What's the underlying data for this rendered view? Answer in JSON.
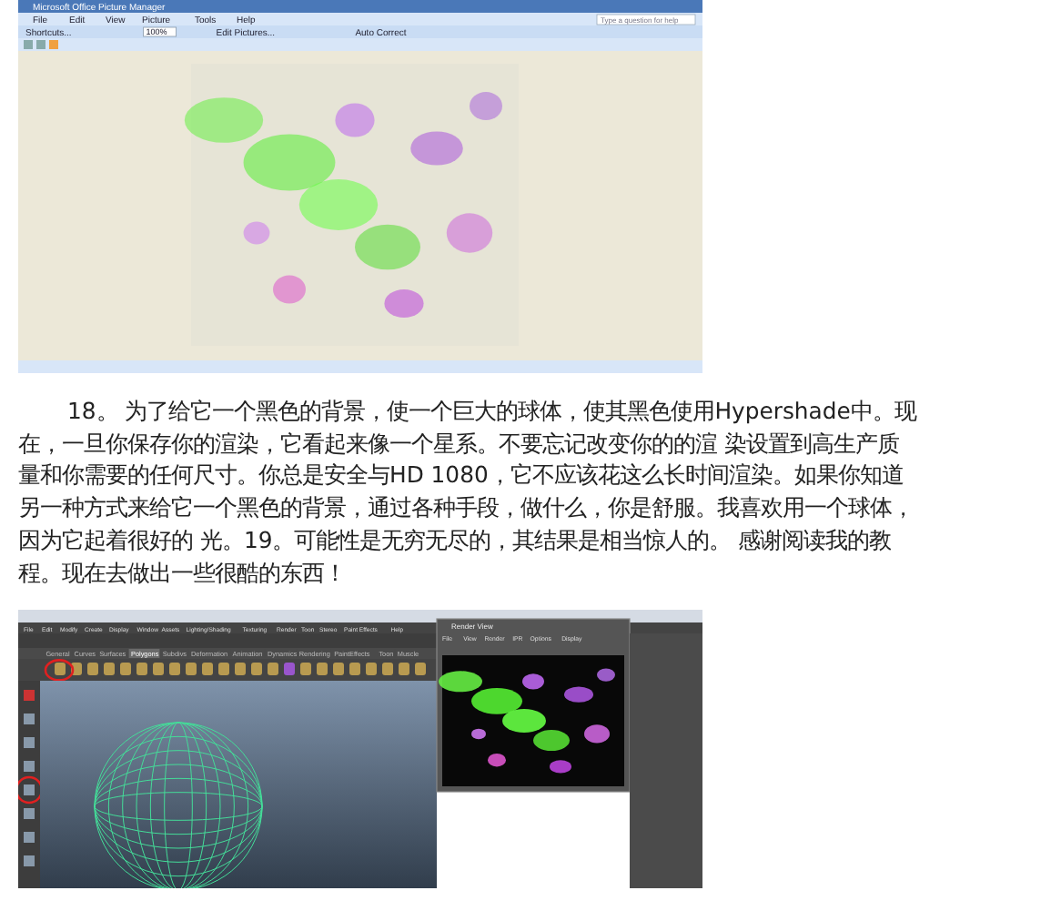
{
  "top_screenshot": {
    "window_title": "Microsoft Office Picture Manager",
    "menu": [
      "File",
      "Edit",
      "View",
      "Picture",
      "Tools",
      "Help"
    ],
    "help_placeholder": "Type a question for help",
    "toolbar": [
      {
        "kind": "button",
        "label": "Shortcuts..."
      },
      {
        "kind": "zoom",
        "label": "100%"
      },
      {
        "kind": "button",
        "label": "Edit Pictures..."
      },
      {
        "kind": "button",
        "label": "Auto Correct"
      }
    ]
  },
  "paragraph": "18。 为了给它一个黑色的背景，使一个巨大的球体，使其黑色使用Hypershade中。现在，一旦你保存你的渲染，它看起来像一个星系。不要忘记改变你的的渲 染设置到高生产质量和你需要的任何尺寸。你总是安全与HD 1080，它不应该花这么长时间渲染。如果你知道另一种方式来给它一个黑色的背景，通过各种手段，做什么，你是舒服。我喜欢用一个球体，因为它起着很好的 光。19。可能性是无穷无尽的，其结果是相当惊人的。  感谢阅读我的教程。现在去做出一些很酷的东西！",
  "bottom_screenshot": {
    "menu": [
      "File",
      "Edit",
      "Modify",
      "Create",
      "Display",
      "Window",
      "Assets",
      "Lighting/Shading",
      "Texturing",
      "Render",
      "Toon",
      "Stereo",
      "Paint Effects",
      "Help"
    ],
    "shelf_tabs": [
      {
        "label": "General",
        "selected": false
      },
      {
        "label": "Curves",
        "selected": false
      },
      {
        "label": "Surfaces",
        "selected": false
      },
      {
        "label": "Polygons",
        "selected": true
      },
      {
        "label": "Subdivs",
        "selected": false
      },
      {
        "label": "Deformation",
        "selected": false
      },
      {
        "label": "Animation",
        "selected": false
      },
      {
        "label": "Dynamics",
        "selected": false
      },
      {
        "label": "Rendering",
        "selected": false
      },
      {
        "label": "PaintEffects",
        "selected": false
      },
      {
        "label": "Toon",
        "selected": false
      },
      {
        "label": "Muscle",
        "selected": false
      }
    ],
    "render_view": {
      "title": "Render View",
      "menu": [
        "File",
        "View",
        "Render",
        "IPR",
        "Options",
        "Display"
      ]
    }
  }
}
